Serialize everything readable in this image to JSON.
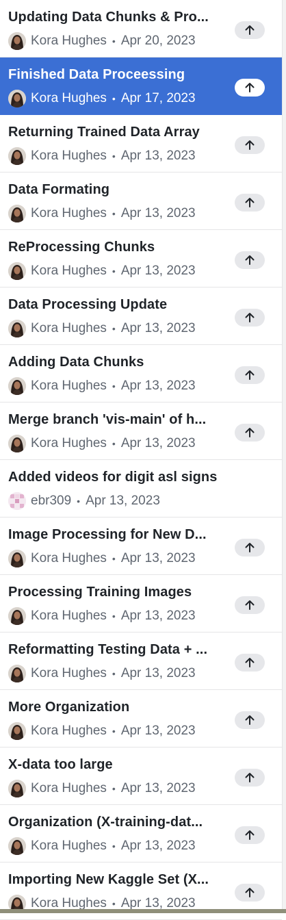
{
  "commits": [
    {
      "title": "Updating Data Chunks & Pro...",
      "author": "Kora Hughes",
      "date": "Apr 20, 2023",
      "avatar": "person",
      "push": true,
      "selected": false
    },
    {
      "title": "Finished Data Proceessing",
      "author": "Kora Hughes",
      "date": "Apr 17, 2023",
      "avatar": "person",
      "push": true,
      "selected": true
    },
    {
      "title": "Returning Trained Data Array",
      "author": "Kora Hughes",
      "date": "Apr 13, 2023",
      "avatar": "person",
      "push": true,
      "selected": false
    },
    {
      "title": "Data Formating",
      "author": "Kora Hughes",
      "date": "Apr 13, 2023",
      "avatar": "person",
      "push": true,
      "selected": false
    },
    {
      "title": "ReProcessing Chunks",
      "author": "Kora Hughes",
      "date": "Apr 13, 2023",
      "avatar": "person",
      "push": true,
      "selected": false
    },
    {
      "title": "Data Processing Update",
      "author": "Kora Hughes",
      "date": "Apr 13, 2023",
      "avatar": "person",
      "push": true,
      "selected": false
    },
    {
      "title": "Adding Data Chunks",
      "author": "Kora Hughes",
      "date": "Apr 13, 2023",
      "avatar": "person",
      "push": true,
      "selected": false
    },
    {
      "title": "Merge branch 'vis-main' of h...",
      "author": "Kora Hughes",
      "date": "Apr 13, 2023",
      "avatar": "person",
      "push": true,
      "selected": false
    },
    {
      "title": "Added videos for digit asl signs",
      "author": "ebr309",
      "date": "Apr 13, 2023",
      "avatar": "identicon",
      "push": false,
      "selected": false
    },
    {
      "title": "Image Processing for New D...",
      "author": "Kora Hughes",
      "date": "Apr 13, 2023",
      "avatar": "person",
      "push": true,
      "selected": false
    },
    {
      "title": "Processing Training Images",
      "author": "Kora Hughes",
      "date": "Apr 13, 2023",
      "avatar": "person",
      "push": true,
      "selected": false
    },
    {
      "title": "Reformatting Testing Data + ...",
      "author": "Kora Hughes",
      "date": "Apr 13, 2023",
      "avatar": "person",
      "push": true,
      "selected": false
    },
    {
      "title": "More Organization",
      "author": "Kora Hughes",
      "date": "Apr 13, 2023",
      "avatar": "person",
      "push": true,
      "selected": false
    },
    {
      "title": "X-data too large",
      "author": "Kora Hughes",
      "date": "Apr 13, 2023",
      "avatar": "person",
      "push": true,
      "selected": false
    },
    {
      "title": "Organization (X-training-dat...",
      "author": "Kora Hughes",
      "date": "Apr 13, 2023",
      "avatar": "person",
      "push": true,
      "selected": false
    },
    {
      "title": "Importing New Kaggle Set (X...",
      "author": "Kora Hughes",
      "date": "Apr 13, 2023",
      "avatar": "person",
      "push": true,
      "selected": false
    }
  ],
  "separator": "•",
  "icons": {
    "push": "arrow-up-icon",
    "person_avatar": "avatar-photo",
    "identicon_avatar": "identicon-avatar"
  },
  "colors": {
    "selected_bg": "#3b6fd4",
    "title": "#1f2328",
    "meta": "#5f6670",
    "push_bg": "#e6e7ea"
  }
}
